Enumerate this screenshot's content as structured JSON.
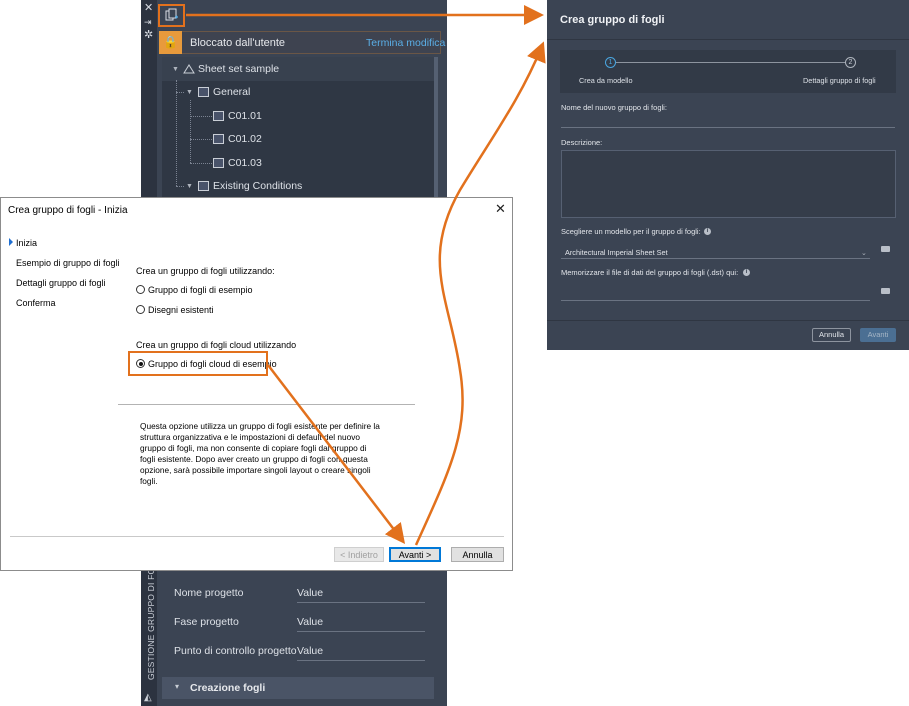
{
  "palette": {
    "lock_text": "Bloccato dall'utente",
    "lock_link": "Termina modifica",
    "tree": {
      "root": "Sheet set sample",
      "group1": "General",
      "sheets": [
        "C01.01",
        "C01.02",
        "C01.03"
      ],
      "group2": "Existing Conditions"
    },
    "props": [
      {
        "label": "Nome progetto",
        "value": "Value"
      },
      {
        "label": "Fase progetto",
        "value": "Value"
      },
      {
        "label": "Punto di controllo progetto",
        "value": "Value"
      }
    ],
    "section": "Creazione fogli",
    "vertical_title": "GESTIONE GRUPPO DI FOGLI"
  },
  "dialog": {
    "title": "Crea gruppo di fogli - Inizia",
    "nav": [
      "Inizia",
      "Esempio di gruppo di fogli",
      "Dettagli gruppo di fogli",
      "Conferma"
    ],
    "create_using": "Crea un gruppo di fogli utilizzando:",
    "opt1": "Gruppo di fogli di esempio",
    "opt2": "Disegni esistenti",
    "cloud_using": "Crea un gruppo di fogli cloud utilizzando",
    "opt3": "Gruppo di fogli cloud di esempio",
    "description": "Questa opzione utilizza un gruppo di fogli esistente per definire la struttura organizzativa e le impostazioni di default del nuovo gruppo di fogli, ma non consente di copiare fogli dal gruppo di fogli esistente. Dopo aver creato un gruppo di fogli con questa opzione, sarà possibile importare singoli layout o creare singoli fogli.",
    "btn_back": "< Indietro",
    "btn_next": "Avanti >",
    "btn_cancel": "Annulla"
  },
  "form": {
    "title": "Crea gruppo di fogli",
    "step1_num": "1",
    "step2_num": "2",
    "step1_label": "Crea da modello",
    "step2_label": "Dettagli gruppo di fogli",
    "name_label": "Nome del nuovo gruppo di fogli:",
    "desc_label": "Descrizione:",
    "template_label": "Scegliere un modello per il gruppo di fogli:",
    "template_value": "Architectural Imperial Sheet Set",
    "dst_label": "Memorizzare il file di dati del gruppo di fogli (.dst) qui:",
    "btn_cancel": "Annulla",
    "btn_next": "Avanti"
  },
  "colors": {
    "accent_orange": "#e2711d",
    "panel_dark": "#3b4453",
    "link_blue": "#5aaee6"
  }
}
